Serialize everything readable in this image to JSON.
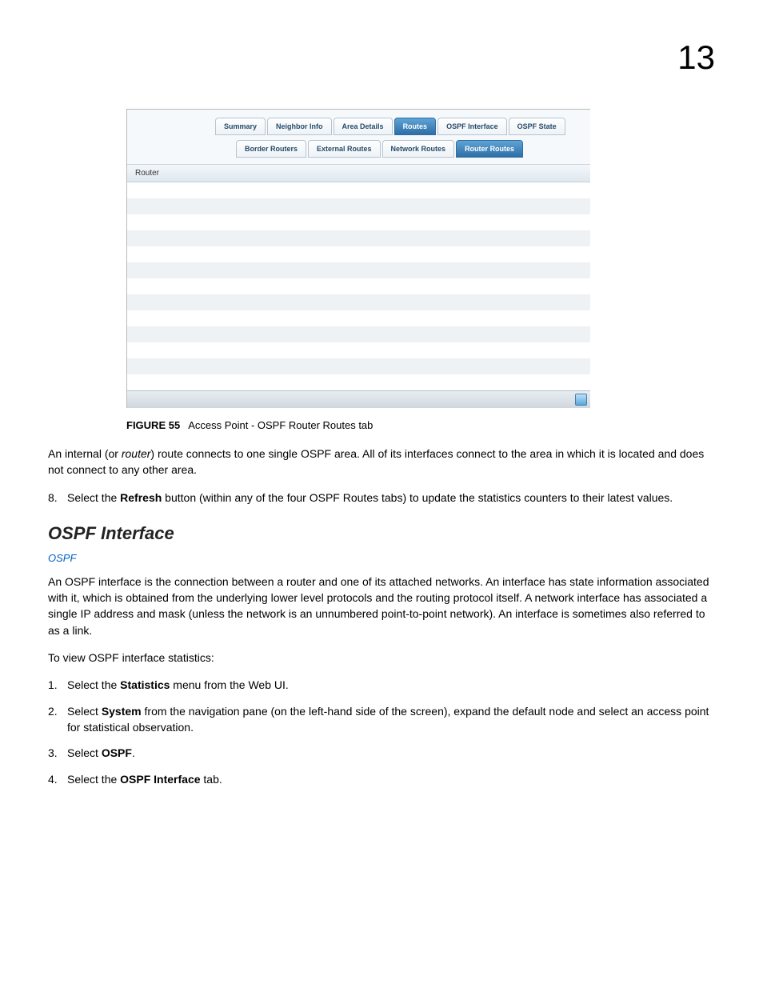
{
  "page_number": "13",
  "figure": {
    "primary_tabs": [
      {
        "label": "Summary",
        "active": false
      },
      {
        "label": "Neighbor Info",
        "active": false
      },
      {
        "label": "Area Details",
        "active": false
      },
      {
        "label": "Routes",
        "active": true
      },
      {
        "label": "OSPF Interface",
        "active": false
      },
      {
        "label": "OSPF State",
        "active": false
      }
    ],
    "secondary_tabs": [
      {
        "label": "Border Routers",
        "active": false
      },
      {
        "label": "External Routes",
        "active": false
      },
      {
        "label": "Network Routes",
        "active": false
      },
      {
        "label": "Router Routes",
        "active": true
      }
    ],
    "column_header": "Router",
    "num_rows": 13
  },
  "caption": {
    "label": "FIGURE 55",
    "text": "Access Point - OSPF Router Routes tab"
  },
  "para1_a": "An internal (or ",
  "para1_router": "router",
  "para1_b": ") route connects to one single OSPF area. All of its interfaces connect to the area in which it is located and does not connect to any other area.",
  "step8": {
    "num": "8.",
    "a": "Select the ",
    "bold": "Refresh",
    "b": " button (within any of the four OSPF Routes tabs) to update the statistics counters to their latest values."
  },
  "section_title": "OSPF Interface",
  "section_link": "OSPF",
  "para2": "An OSPF interface is the connection between a router and one of its attached networks. An interface has state information associated with it, which is obtained from the underlying lower level protocols and the routing protocol itself. A network interface has associated a single IP address and mask (unless the network is an unnumbered point-to-point network). An interface is sometimes also referred to as a link.",
  "para3": "To view OSPF interface statistics:",
  "steps": [
    {
      "num": "1.",
      "a": "Select the ",
      "bold": "Statistics",
      "b": " menu from the Web UI."
    },
    {
      "num": "2.",
      "a": "Select ",
      "bold": "System",
      "b": " from the navigation pane (on the left-hand side of the screen), expand the default node and select an access point for statistical observation."
    },
    {
      "num": "3.",
      "a": "Select ",
      "bold": "OSPF",
      "b": "."
    },
    {
      "num": "4.",
      "a": "Select the ",
      "bold": "OSPF Interface",
      "b": " tab."
    }
  ]
}
